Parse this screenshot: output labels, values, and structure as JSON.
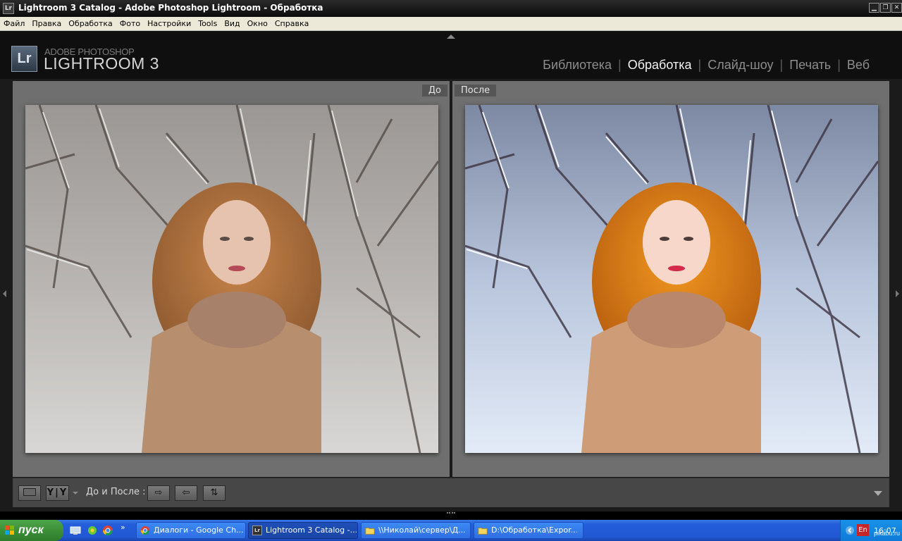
{
  "window": {
    "title": "Lightroom 3 Catalog - Adobe Photoshop Lightroom - Обработка",
    "app_icon": "Lr",
    "controls": [
      "minimize",
      "restore",
      "close"
    ]
  },
  "menubar": {
    "items": [
      "Файл",
      "Правка",
      "Обработка",
      "Фото",
      "Настройки",
      "Tools",
      "Вид",
      "Окно",
      "Справка"
    ]
  },
  "header": {
    "logo_badge": "Lr",
    "logo_top": "ADOBE PHOTOSHOP",
    "logo_main": "LIGHTROOM 3",
    "modules": [
      {
        "label": "Библиотека",
        "active": false
      },
      {
        "label": "Обработка",
        "active": true
      },
      {
        "label": "Слайд-шоу",
        "active": false
      },
      {
        "label": "Печать",
        "active": false
      },
      {
        "label": "Веб",
        "active": false
      }
    ],
    "separator": "|"
  },
  "compare": {
    "before_label": "До",
    "after_label": "После"
  },
  "toolbar": {
    "yy_label": "Y|Y",
    "before_after_label": "До и После :",
    "icons": [
      "loupe-view-icon",
      "before-after-view-icon",
      "copy-before-to-after-icon",
      "copy-after-to-before-icon",
      "swap-before-after-icon",
      "toolbar-menu-icon"
    ]
  },
  "taskbar": {
    "start_label": "пуск",
    "quick_launch": [
      "show-desktop-icon",
      "icq-icon",
      "chrome-icon"
    ],
    "tasks": [
      {
        "label": "Диалоги - Google Ch...",
        "icon": "chrome-icon",
        "active": false
      },
      {
        "label": "Lightroom 3 Catalog -...",
        "icon": "lightroom-icon",
        "active": true
      },
      {
        "label": "\\\\Николай\\сервер\\Д...",
        "icon": "folder-icon",
        "active": false
      },
      {
        "label": "D:\\Обработка\\Expor...",
        "icon": "folder-icon",
        "active": false
      }
    ],
    "language": "En",
    "clock": "16:07",
    "watermark": "pikabu.ru"
  }
}
